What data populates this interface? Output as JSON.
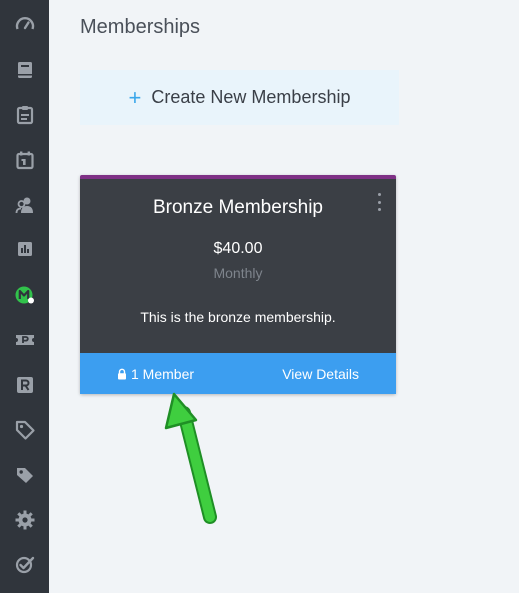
{
  "sidebar": {
    "items": [
      {
        "icon": "dashboard-gauge-icon"
      },
      {
        "icon": "book-icon"
      },
      {
        "icon": "clipboard-icon"
      },
      {
        "icon": "calendar-icon"
      },
      {
        "icon": "users-icon"
      },
      {
        "icon": "bar-chart-icon"
      },
      {
        "icon": "memberships-m-icon",
        "active": true
      },
      {
        "icon": "ticket-p-icon"
      },
      {
        "icon": "register-r-icon"
      },
      {
        "icon": "tag-icon"
      },
      {
        "icon": "tags-icon"
      },
      {
        "icon": "gear-icon"
      },
      {
        "icon": "check-badge-icon"
      }
    ],
    "accent_color": "#31c24b"
  },
  "main": {
    "title": "Memberships",
    "create_button": {
      "icon": "+",
      "label": "Create New Membership"
    }
  },
  "card": {
    "title": "Bronze Membership",
    "price": "$40.00",
    "period": "Monthly",
    "description": "This is the bronze membership.",
    "member_count": "1 Member",
    "view_details": "View Details",
    "top_border_color": "#7f3186",
    "footer_color": "#3c9ef0"
  },
  "annotation": {
    "color": "#3fce3f"
  }
}
